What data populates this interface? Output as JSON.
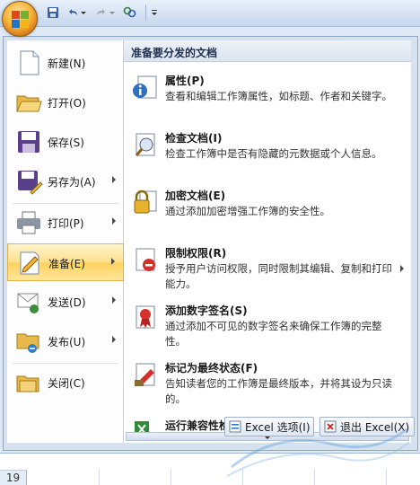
{
  "left_menu": {
    "items": [
      {
        "label": "新建(N)",
        "icon": "new-document-icon"
      },
      {
        "label": "打开(O)",
        "icon": "open-folder-icon"
      },
      {
        "label": "保存(S)",
        "icon": "save-disk-icon"
      },
      {
        "label": "另存为(A)",
        "icon": "save-as-icon"
      },
      {
        "label": "打印(P)",
        "icon": "printer-icon"
      },
      {
        "label": "准备(E)",
        "icon": "prepare-icon"
      },
      {
        "label": "发送(D)",
        "icon": "send-icon"
      },
      {
        "label": "发布(U)",
        "icon": "publish-icon"
      },
      {
        "label": "关闭(C)",
        "icon": "close-folder-icon"
      }
    ]
  },
  "submenu": {
    "header": "准备要分发的文档",
    "items": [
      {
        "title": "属性(P)",
        "desc": "查看和编辑工作簿属性，如标题、作者和关键字。",
        "icon": "properties-icon"
      },
      {
        "title": "检查文档(I)",
        "desc": "检查工作簿中是否有隐藏的元数据或个人信息。",
        "icon": "inspect-document-icon"
      },
      {
        "title": "加密文档(E)",
        "desc": "通过添加加密增强工作簿的安全性。",
        "icon": "encrypt-lock-icon"
      },
      {
        "title": "限制权限(R)",
        "desc": "授予用户访问权限，同时限制其编辑、复制和打印能力。",
        "icon": "restrict-permission-icon"
      },
      {
        "title": "添加数字签名(S)",
        "desc": "通过添加不可见的数字签名来确保工作簿的完整性。",
        "icon": "digital-signature-icon"
      },
      {
        "title": "标记为最终状态(F)",
        "desc": "告知读者您的工作簿是最终版本，并将其设为只读的。",
        "icon": "mark-final-icon"
      },
      {
        "title": "运行兼容性检查器(C)",
        "desc": "",
        "icon": "compatibility-checker-icon"
      }
    ]
  },
  "bottom": {
    "options_label": "Excel 选项(I)",
    "exit_label": "退出 Excel(X)"
  },
  "sheet": {
    "row_number": "19"
  },
  "colors": {
    "accent_selected": "#ffd25e",
    "office_orange": "#f8b43a"
  }
}
